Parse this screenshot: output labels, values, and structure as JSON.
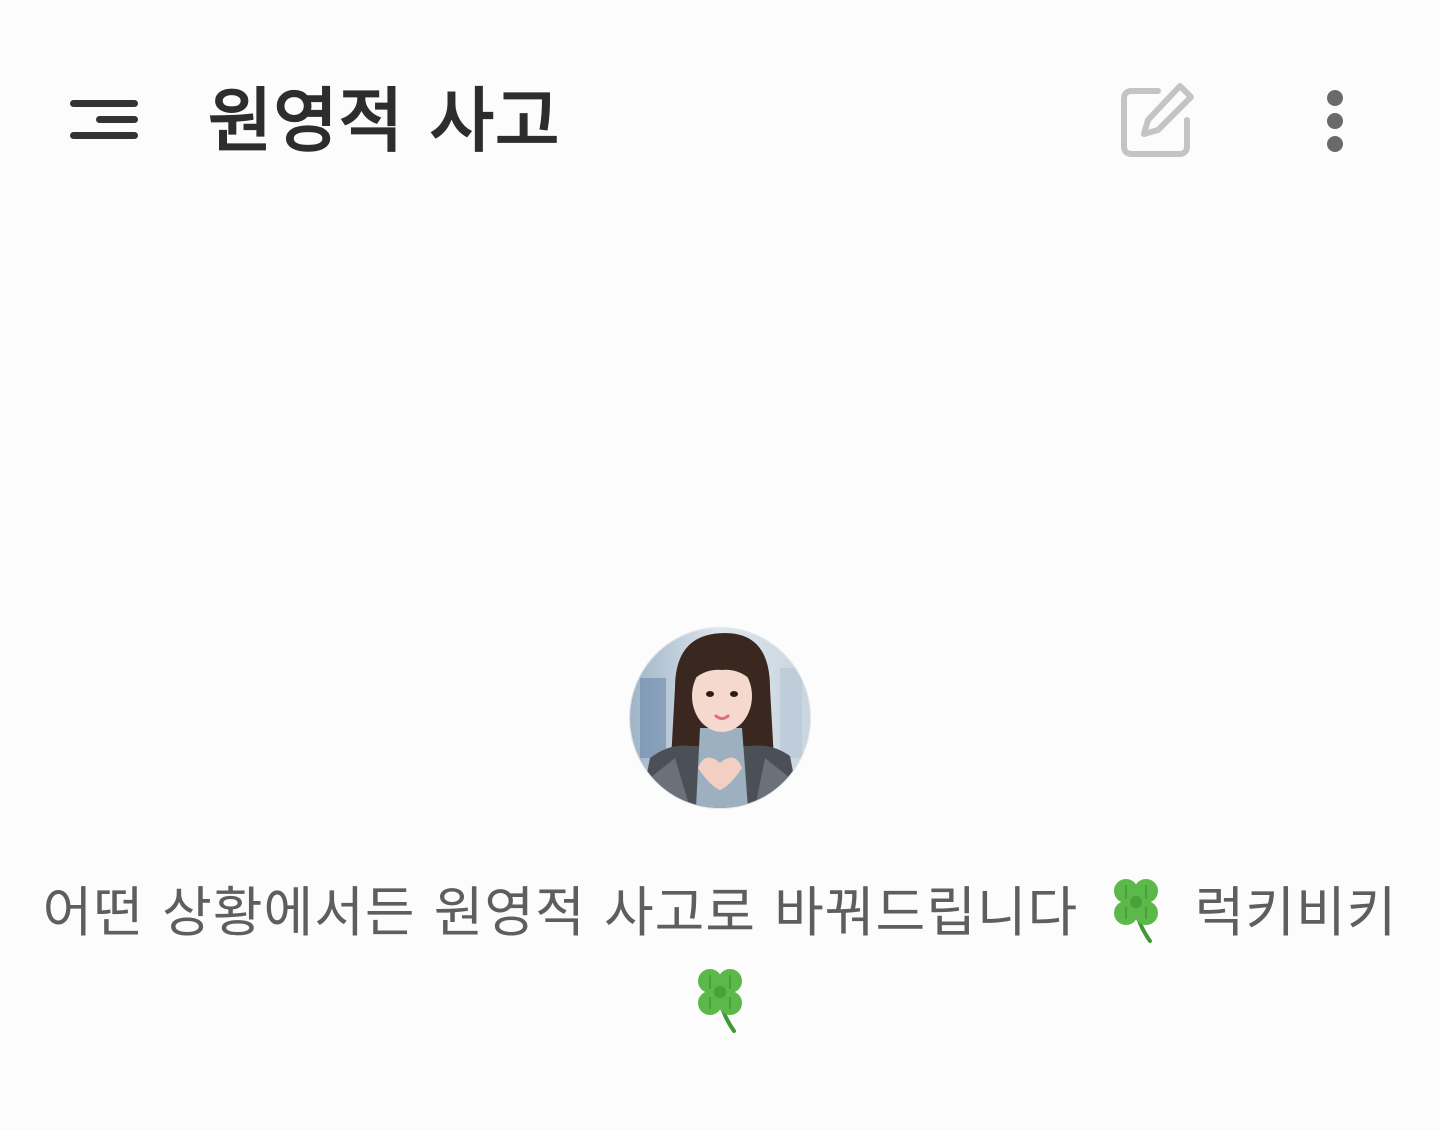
{
  "header": {
    "title": "원영적 사고",
    "menu_icon": "menu-icon",
    "edit_icon": "edit-icon",
    "more_icon": "more-vert-icon"
  },
  "profile": {
    "avatar_icon": "profile-photo",
    "description_part1": "어떤 상황에서든 원영적 사고로 바꿔드립니다",
    "description_part2": "럭키비키",
    "emoji_icon": "four-leaf-clover-icon"
  },
  "colors": {
    "background": "#fcfcfc",
    "title_text": "#2d2d2d",
    "description_text": "#5e5e5e",
    "edit_icon": "#c4c4c4",
    "more_icon": "#6a6a6a",
    "clover_green": "#4caf50"
  }
}
